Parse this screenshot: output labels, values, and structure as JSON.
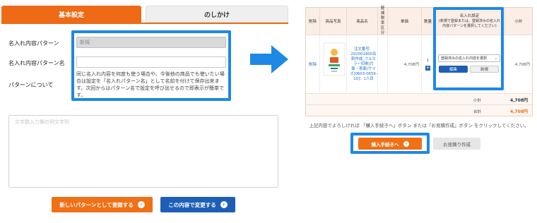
{
  "left": {
    "tabs": [
      {
        "label": "基本設定"
      },
      {
        "label": "のしかけ"
      }
    ],
    "fields": {
      "pattern_label": "名入れ内容パターン",
      "pattern_value": "新規",
      "pattern_name_label": "名入れ内容パターン名",
      "pattern_name_value": "",
      "about_label": "パターンについて",
      "about_text": "同じ名入れ内容を何度も使う場合や、今後他の商品でも使いたい場合は設定を「名入れパターン名」として名前を付けて保存出来ます。次回からはパターン名で設定を呼び出せるので即表示が簡単です。"
    },
    "textarea_placeholder": "文字数入力欄の例文字列",
    "buttons": {
      "register_new": "新しいパターンとして登録する",
      "change": "この内容で変更する"
    }
  },
  "cart": {
    "headers": {
      "delete": "削除",
      "photo": "商品写真",
      "name": "商品名",
      "tax": "軽減税率区分",
      "price": "単価",
      "qty": "数量",
      "nameire": "名入れ設定",
      "nameire_sub": "(新規で登録または、登録済みの名入れ内容パターンを選択してください)",
      "subtotal": "小計"
    },
    "row": {
      "delete_link": "削除",
      "product_name": "注文番号：202001800名刺作成_フルカラー印刷(片面・表面)サイズ[0603-0656-10]：1人目",
      "unit_price": "4,708円",
      "qty": "1",
      "qty_plus": "+",
      "select_value": "登録済みの名入れ内容を選択",
      "select_arrow": "⌄",
      "edit_button": "編集",
      "new_button": "新規",
      "line_total": "4,708円"
    },
    "summary": {
      "subtotal_label": "小計",
      "subtotal_value": "4,708円",
      "total_label": "合計",
      "total_value": "4,708円"
    },
    "note": "上記内容でよろしければ 「購入手続きへ」ボタン または「お見積作成」ボタン をクリックしてください。",
    "proceed_button": "購入手続きへ",
    "quote_button": "お見積り作成"
  },
  "colors": {
    "accent_orange": "#ee6a16",
    "accent_blue": "#1d5fb7",
    "highlight_blue": "#1e88e5"
  },
  "icons": {
    "arrow_right_icon": "›",
    "transition_arrow": "right-arrow"
  }
}
